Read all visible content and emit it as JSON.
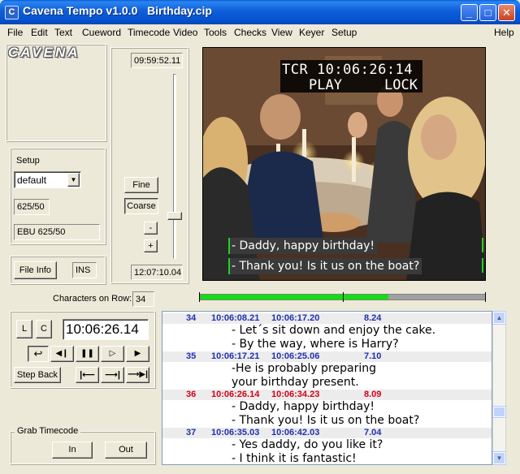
{
  "window": {
    "title": "Cavena Tempo v1.0.0   Birthday.cip",
    "icon_name": "app-icon",
    "controls": [
      "minimize-icon",
      "maximize-icon",
      "close-icon"
    ]
  },
  "menu": [
    "File",
    "Edit",
    "Text",
    "Cueword",
    "Timecode",
    "Video",
    "Tools",
    "Checks",
    "View",
    "Keyer",
    "Setup",
    "Help"
  ],
  "logo": "CAVENA",
  "setup": {
    "legend": "Setup",
    "preset_value": "default",
    "frame_rate": "625/50",
    "standard": "EBU 625/50"
  },
  "file_info_label": "File Info",
  "ins_label": "INS",
  "jog": {
    "top_time": "09:59:52.11",
    "bottom_time": "12:07:10.04",
    "fine_label": "Fine",
    "coarse_label": "Coarse",
    "minus_label": "-",
    "plus_label": "+",
    "slider_level": 0.78
  },
  "video": {
    "tcr_line": "TCR 10:06:26:14",
    "status_play": "PLAY",
    "status_lock": "LOCK",
    "subtitle_lines": [
      "- Daddy, happy birthday!",
      "- Thank you! Is it us on the boat?"
    ]
  },
  "characters_on_row": {
    "label": "Characters on Row:",
    "value": "34"
  },
  "progress": {
    "green_fraction": 0.66,
    "marker_fraction": 0.5
  },
  "transport": {
    "l_label": "L",
    "c_label": "C",
    "timecode": "10:06:26.14",
    "step_back_label": "Step Back"
  },
  "grab": {
    "legend": "Grab Timecode",
    "in_label": "In",
    "out_label": "Out"
  },
  "subtitles": [
    {
      "num": "34",
      "tc_in": "10:06:08.21",
      "tc_out": "10:06:17.20",
      "dur": "8.24",
      "current": false,
      "lines": [
        "- Let´s sit down and enjoy the cake.",
        "- By the way, where is Harry?"
      ]
    },
    {
      "num": "35",
      "tc_in": "10:06:17.21",
      "tc_out": "10:06:25.06",
      "dur": "7.10",
      "current": false,
      "lines": [
        "-He is probably preparing",
        "your birthday present."
      ]
    },
    {
      "num": "36",
      "tc_in": "10:06:26.14",
      "tc_out": "10:06:34.23",
      "dur": "8.09",
      "current": true,
      "lines": [
        "- Daddy, happy birthday!",
        "- Thank you! Is it us on the boat?"
      ]
    },
    {
      "num": "37",
      "tc_in": "10:06:35.03",
      "tc_out": "10:06:42.03",
      "dur": "7.04",
      "current": false,
      "lines": [
        "- Yes daddy, do you like it?",
        "- I think it is fantastic!"
      ]
    }
  ]
}
